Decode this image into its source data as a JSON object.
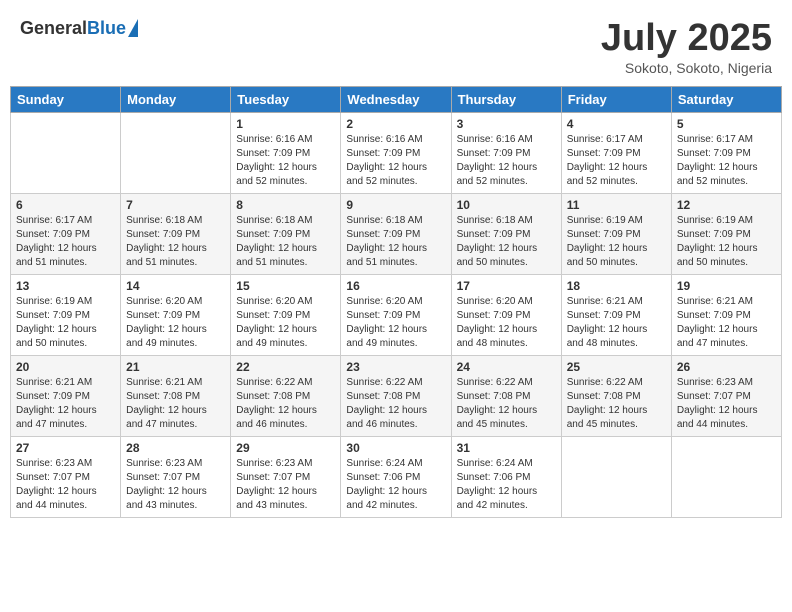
{
  "header": {
    "logo_general": "General",
    "logo_blue": "Blue",
    "month_year": "July 2025",
    "location": "Sokoto, Sokoto, Nigeria"
  },
  "weekdays": [
    "Sunday",
    "Monday",
    "Tuesday",
    "Wednesday",
    "Thursday",
    "Friday",
    "Saturday"
  ],
  "weeks": [
    [
      {
        "day": "",
        "sunrise": "",
        "sunset": "",
        "daylight": ""
      },
      {
        "day": "",
        "sunrise": "",
        "sunset": "",
        "daylight": ""
      },
      {
        "day": "1",
        "sunrise": "Sunrise: 6:16 AM",
        "sunset": "Sunset: 7:09 PM",
        "daylight": "Daylight: 12 hours and 52 minutes."
      },
      {
        "day": "2",
        "sunrise": "Sunrise: 6:16 AM",
        "sunset": "Sunset: 7:09 PM",
        "daylight": "Daylight: 12 hours and 52 minutes."
      },
      {
        "day": "3",
        "sunrise": "Sunrise: 6:16 AM",
        "sunset": "Sunset: 7:09 PM",
        "daylight": "Daylight: 12 hours and 52 minutes."
      },
      {
        "day": "4",
        "sunrise": "Sunrise: 6:17 AM",
        "sunset": "Sunset: 7:09 PM",
        "daylight": "Daylight: 12 hours and 52 minutes."
      },
      {
        "day": "5",
        "sunrise": "Sunrise: 6:17 AM",
        "sunset": "Sunset: 7:09 PM",
        "daylight": "Daylight: 12 hours and 52 minutes."
      }
    ],
    [
      {
        "day": "6",
        "sunrise": "Sunrise: 6:17 AM",
        "sunset": "Sunset: 7:09 PM",
        "daylight": "Daylight: 12 hours and 51 minutes."
      },
      {
        "day": "7",
        "sunrise": "Sunrise: 6:18 AM",
        "sunset": "Sunset: 7:09 PM",
        "daylight": "Daylight: 12 hours and 51 minutes."
      },
      {
        "day": "8",
        "sunrise": "Sunrise: 6:18 AM",
        "sunset": "Sunset: 7:09 PM",
        "daylight": "Daylight: 12 hours and 51 minutes."
      },
      {
        "day": "9",
        "sunrise": "Sunrise: 6:18 AM",
        "sunset": "Sunset: 7:09 PM",
        "daylight": "Daylight: 12 hours and 51 minutes."
      },
      {
        "day": "10",
        "sunrise": "Sunrise: 6:18 AM",
        "sunset": "Sunset: 7:09 PM",
        "daylight": "Daylight: 12 hours and 50 minutes."
      },
      {
        "day": "11",
        "sunrise": "Sunrise: 6:19 AM",
        "sunset": "Sunset: 7:09 PM",
        "daylight": "Daylight: 12 hours and 50 minutes."
      },
      {
        "day": "12",
        "sunrise": "Sunrise: 6:19 AM",
        "sunset": "Sunset: 7:09 PM",
        "daylight": "Daylight: 12 hours and 50 minutes."
      }
    ],
    [
      {
        "day": "13",
        "sunrise": "Sunrise: 6:19 AM",
        "sunset": "Sunset: 7:09 PM",
        "daylight": "Daylight: 12 hours and 50 minutes."
      },
      {
        "day": "14",
        "sunrise": "Sunrise: 6:20 AM",
        "sunset": "Sunset: 7:09 PM",
        "daylight": "Daylight: 12 hours and 49 minutes."
      },
      {
        "day": "15",
        "sunrise": "Sunrise: 6:20 AM",
        "sunset": "Sunset: 7:09 PM",
        "daylight": "Daylight: 12 hours and 49 minutes."
      },
      {
        "day": "16",
        "sunrise": "Sunrise: 6:20 AM",
        "sunset": "Sunset: 7:09 PM",
        "daylight": "Daylight: 12 hours and 49 minutes."
      },
      {
        "day": "17",
        "sunrise": "Sunrise: 6:20 AM",
        "sunset": "Sunset: 7:09 PM",
        "daylight": "Daylight: 12 hours and 48 minutes."
      },
      {
        "day": "18",
        "sunrise": "Sunrise: 6:21 AM",
        "sunset": "Sunset: 7:09 PM",
        "daylight": "Daylight: 12 hours and 48 minutes."
      },
      {
        "day": "19",
        "sunrise": "Sunrise: 6:21 AM",
        "sunset": "Sunset: 7:09 PM",
        "daylight": "Daylight: 12 hours and 47 minutes."
      }
    ],
    [
      {
        "day": "20",
        "sunrise": "Sunrise: 6:21 AM",
        "sunset": "Sunset: 7:09 PM",
        "daylight": "Daylight: 12 hours and 47 minutes."
      },
      {
        "day": "21",
        "sunrise": "Sunrise: 6:21 AM",
        "sunset": "Sunset: 7:08 PM",
        "daylight": "Daylight: 12 hours and 47 minutes."
      },
      {
        "day": "22",
        "sunrise": "Sunrise: 6:22 AM",
        "sunset": "Sunset: 7:08 PM",
        "daylight": "Daylight: 12 hours and 46 minutes."
      },
      {
        "day": "23",
        "sunrise": "Sunrise: 6:22 AM",
        "sunset": "Sunset: 7:08 PM",
        "daylight": "Daylight: 12 hours and 46 minutes."
      },
      {
        "day": "24",
        "sunrise": "Sunrise: 6:22 AM",
        "sunset": "Sunset: 7:08 PM",
        "daylight": "Daylight: 12 hours and 45 minutes."
      },
      {
        "day": "25",
        "sunrise": "Sunrise: 6:22 AM",
        "sunset": "Sunset: 7:08 PM",
        "daylight": "Daylight: 12 hours and 45 minutes."
      },
      {
        "day": "26",
        "sunrise": "Sunrise: 6:23 AM",
        "sunset": "Sunset: 7:07 PM",
        "daylight": "Daylight: 12 hours and 44 minutes."
      }
    ],
    [
      {
        "day": "27",
        "sunrise": "Sunrise: 6:23 AM",
        "sunset": "Sunset: 7:07 PM",
        "daylight": "Daylight: 12 hours and 44 minutes."
      },
      {
        "day": "28",
        "sunrise": "Sunrise: 6:23 AM",
        "sunset": "Sunset: 7:07 PM",
        "daylight": "Daylight: 12 hours and 43 minutes."
      },
      {
        "day": "29",
        "sunrise": "Sunrise: 6:23 AM",
        "sunset": "Sunset: 7:07 PM",
        "daylight": "Daylight: 12 hours and 43 minutes."
      },
      {
        "day": "30",
        "sunrise": "Sunrise: 6:24 AM",
        "sunset": "Sunset: 7:06 PM",
        "daylight": "Daylight: 12 hours and 42 minutes."
      },
      {
        "day": "31",
        "sunrise": "Sunrise: 6:24 AM",
        "sunset": "Sunset: 7:06 PM",
        "daylight": "Daylight: 12 hours and 42 minutes."
      },
      {
        "day": "",
        "sunrise": "",
        "sunset": "",
        "daylight": ""
      },
      {
        "day": "",
        "sunrise": "",
        "sunset": "",
        "daylight": ""
      }
    ]
  ]
}
